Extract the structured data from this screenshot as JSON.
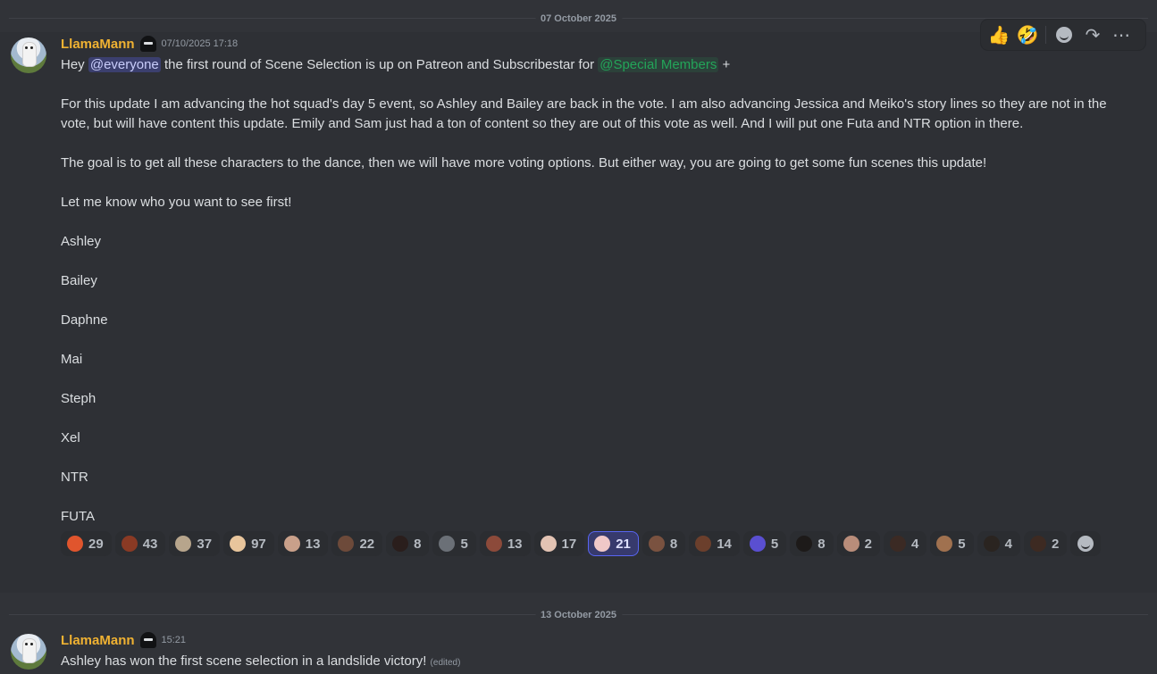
{
  "dates": {
    "first": "07 October 2025",
    "second": "13 October 2025"
  },
  "message1": {
    "author": "LlamaMann",
    "timestamp": "07/10/2025 17:18",
    "line1": {
      "hey": "Hey ",
      "mention": "@everyone",
      "text": " the first round of Scene Selection is up on Patreon and Subscribestar for ",
      "role": "@Special Members",
      "tail": " +"
    },
    "para1_line1": "For this update I am advancing the hot squad's day 5 event, so Ashley and Bailey are back in the vote. I am also advancing Jessica and Meiko's story lines so they are not in the",
    "para1_line2": "vote, but will have content this update. Emily and Sam just had a ton of content so they are out of this vote as well.  And I will put one Futa and NTR option in there.",
    "para2": "The goal is to get all these characters to the dance, then we will have more voting options. But either way, you are going to get some fun scenes this update!",
    "para3": "Let me know who you want to see first!",
    "options": [
      "Ashley",
      "Bailey",
      "Daphne",
      "Mai",
      "Steph",
      "Xel",
      "NTR",
      "FUTA"
    ],
    "reactions": [
      {
        "count": "29",
        "color": "#e0552d",
        "me": false
      },
      {
        "count": "43",
        "color": "#8a3a24",
        "me": false
      },
      {
        "count": "37",
        "color": "#b7a58c",
        "me": false
      },
      {
        "count": "97",
        "color": "#e8c59c",
        "me": false
      },
      {
        "count": "13",
        "color": "#c9a08a",
        "me": false
      },
      {
        "count": "22",
        "color": "#6d4a3a",
        "me": false
      },
      {
        "count": "8",
        "color": "#2a1e1c",
        "me": false
      },
      {
        "count": "5",
        "color": "#6b7077",
        "me": false
      },
      {
        "count": "13",
        "color": "#8c4a3a",
        "me": false
      },
      {
        "count": "17",
        "color": "#e3c3b3",
        "me": false
      },
      {
        "count": "21",
        "color": "#f0c8c8",
        "me": true
      },
      {
        "count": "8",
        "color": "#7a5240",
        "me": false
      },
      {
        "count": "14",
        "color": "#6b3f2c",
        "me": false
      },
      {
        "count": "5",
        "color": "#5a4fd1",
        "me": false
      },
      {
        "count": "8",
        "color": "#1d1a19",
        "me": false
      },
      {
        "count": "2",
        "color": "#b98d7a",
        "me": false
      },
      {
        "count": "4",
        "color": "#3b2a24",
        "me": false
      },
      {
        "count": "5",
        "color": "#a0714f",
        "me": false
      },
      {
        "count": "4",
        "color": "#2a2420",
        "me": false
      },
      {
        "count": "2",
        "color": "#3d2a22",
        "me": false
      }
    ]
  },
  "message2": {
    "author": "LlamaMann",
    "timestamp": "15:21",
    "text": "Ashley has won the first scene selection in a landslide victory!",
    "edited": "(edited)"
  },
  "toolbar": {
    "icons": [
      "thumbs-up-icon",
      "rofl-icon",
      "add-reaction-icon",
      "forward-icon",
      "more-icon"
    ]
  }
}
